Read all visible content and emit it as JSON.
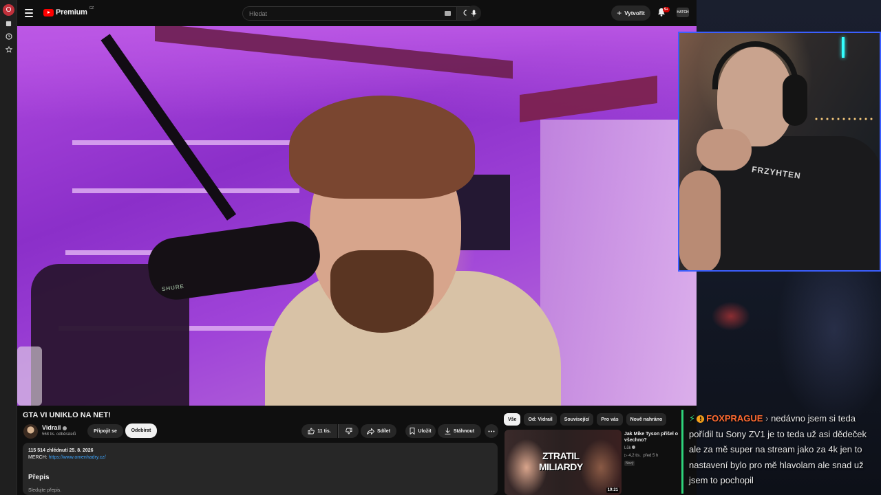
{
  "browser": {
    "strip_icons": [
      "opera-icon",
      "bookmark-icon",
      "history-icon",
      "star-icon"
    ]
  },
  "header": {
    "logo_text": "Premium",
    "logo_sup": "CZ",
    "search_placeholder": "Hledat",
    "create_label": "Vytvořit",
    "notification_badge": "9+",
    "avatar_label": "HATCH"
  },
  "video": {
    "title": "GTA VI UNIKLO NA NET!",
    "mic_label": "SHURE"
  },
  "channel": {
    "name": "Vidrail",
    "subscribers": "568 tis. odběratelů",
    "join_label": "Připojit se",
    "subscribe_label": "Odebírat"
  },
  "actions": {
    "likes": "11 tis.",
    "share_label": "Sdílet",
    "save_label": "Uložit",
    "download_label": "Stáhnout"
  },
  "description": {
    "stats": "115 514 zhlédnutí  25. 8. 2026",
    "merch_label": "MERCH:",
    "merch_link": "https://www.omenhadry.cz/",
    "transcript_heading": "Přepis",
    "transcript_sub": "Sledujte přepis."
  },
  "chips": [
    "Vše",
    "Od: Vidrail",
    "Související",
    "Pro vás",
    "Nově nahráno"
  ],
  "recommendation": {
    "thumb_text_line1": "ZTRATIL",
    "thumb_text_line2": "MILIARDY",
    "duration": "19:21",
    "title": "Jak Mike Tyson přišel o všechno?",
    "channel": "Lůk",
    "views": "4,2 tis.",
    "age": "před 5 h",
    "badge": "Nový"
  },
  "webcam": {
    "shirt_text": "FRZYHTEN"
  },
  "chat": {
    "username": "FOXPRAGUE",
    "badge_symbol": "!",
    "separator": "›",
    "message": "nedávno jsem si teda pořídil tu Sony ZV1 je to teda už asi dědeček ale za mě super na stream jako za 4k jen to nastavení bylo pro mě hlavolam ale snad už jsem to pochopil"
  }
}
